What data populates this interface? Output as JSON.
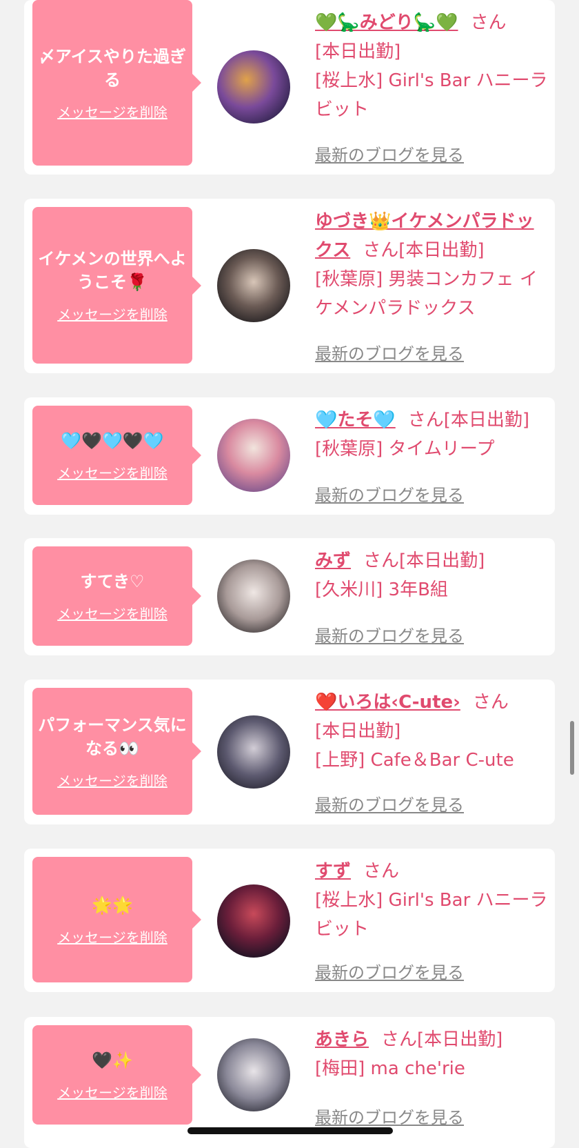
{
  "common": {
    "delete_label": "メッセージを削除",
    "san": "さん",
    "blog_label": "最新のブログを見る"
  },
  "colors": {
    "bubble": "#ff8fa3",
    "name": "#e04a6e",
    "blog": "#888888",
    "background": "#f2f2f2"
  },
  "cards": [
    {
      "message": "〆アイスやりた過ぎる",
      "name": "💚🦕みどり🦕💚",
      "status": "[本日出勤]",
      "location": "[桜上水] Girl's Bar ハニーラビット"
    },
    {
      "message": "イケメンの世界へようこそ🌹",
      "name": "ゆづき👑イケメンパラドックス",
      "status": "[本日出勤]",
      "location": "[秋葉原] 男装コンカフェ イケメンパラドックス"
    },
    {
      "message": "🩵🖤🩵🖤🩵",
      "name": "🩵たそ🩵",
      "status": "[本日出勤]",
      "location": "[秋葉原] タイムリープ"
    },
    {
      "message": "すてき♡",
      "name": "みず",
      "status": "[本日出勤]",
      "location": "[久米川] 3年B組"
    },
    {
      "message": "パフォーマンス気になる👀",
      "name": "❤️いろは‹C-ute›",
      "status": "[本日出勤]",
      "location": "[上野] Cafe＆Bar C-ute"
    },
    {
      "message": "🌟🌟",
      "name": "すず",
      "status": "",
      "location": "[桜上水] Girl's Bar ハニーラビット"
    },
    {
      "message": "🖤✨",
      "name": "あきら",
      "status": "[本日出勤]",
      "location": "[梅田] ma che'rie"
    }
  ]
}
